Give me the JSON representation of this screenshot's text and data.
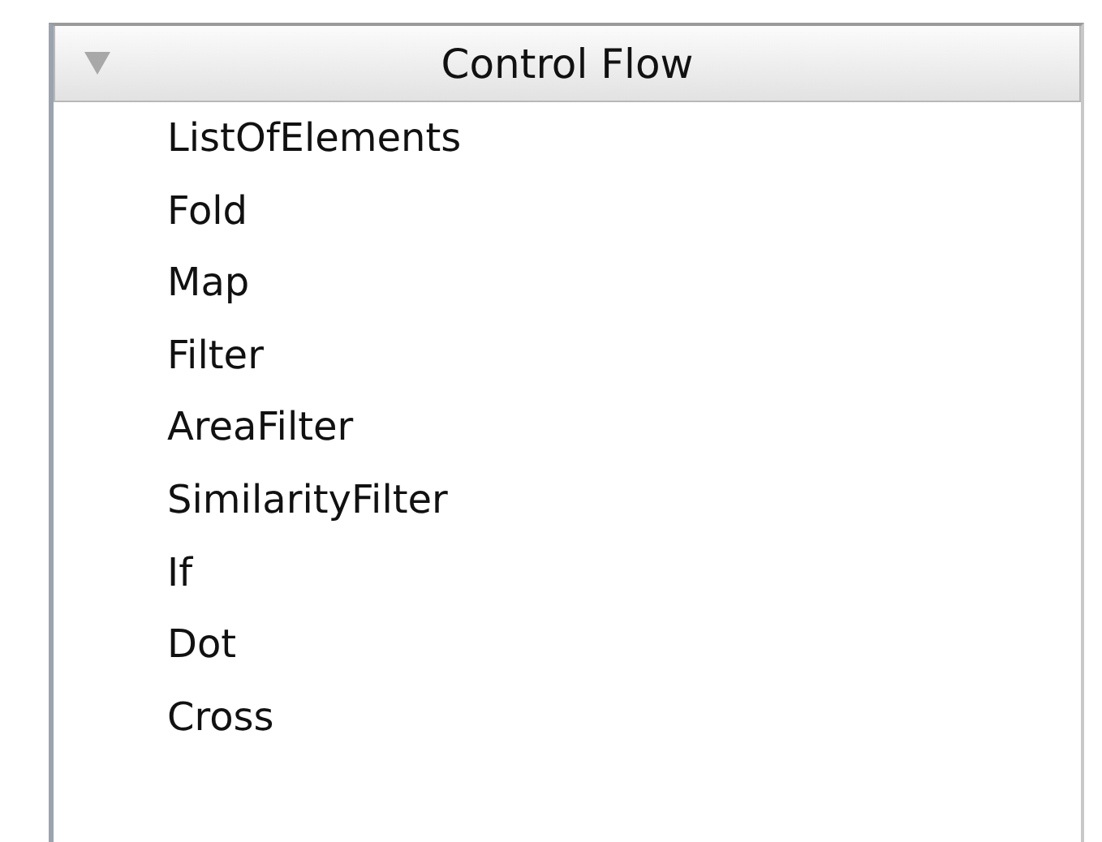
{
  "section": {
    "title": "Control Flow",
    "expanded": true,
    "items": [
      {
        "label": "ListOfElements"
      },
      {
        "label": "Fold"
      },
      {
        "label": "Map"
      },
      {
        "label": "Filter"
      },
      {
        "label": "AreaFilter"
      },
      {
        "label": "SimilarityFilter"
      },
      {
        "label": "If"
      },
      {
        "label": "Dot"
      },
      {
        "label": "Cross"
      }
    ]
  }
}
